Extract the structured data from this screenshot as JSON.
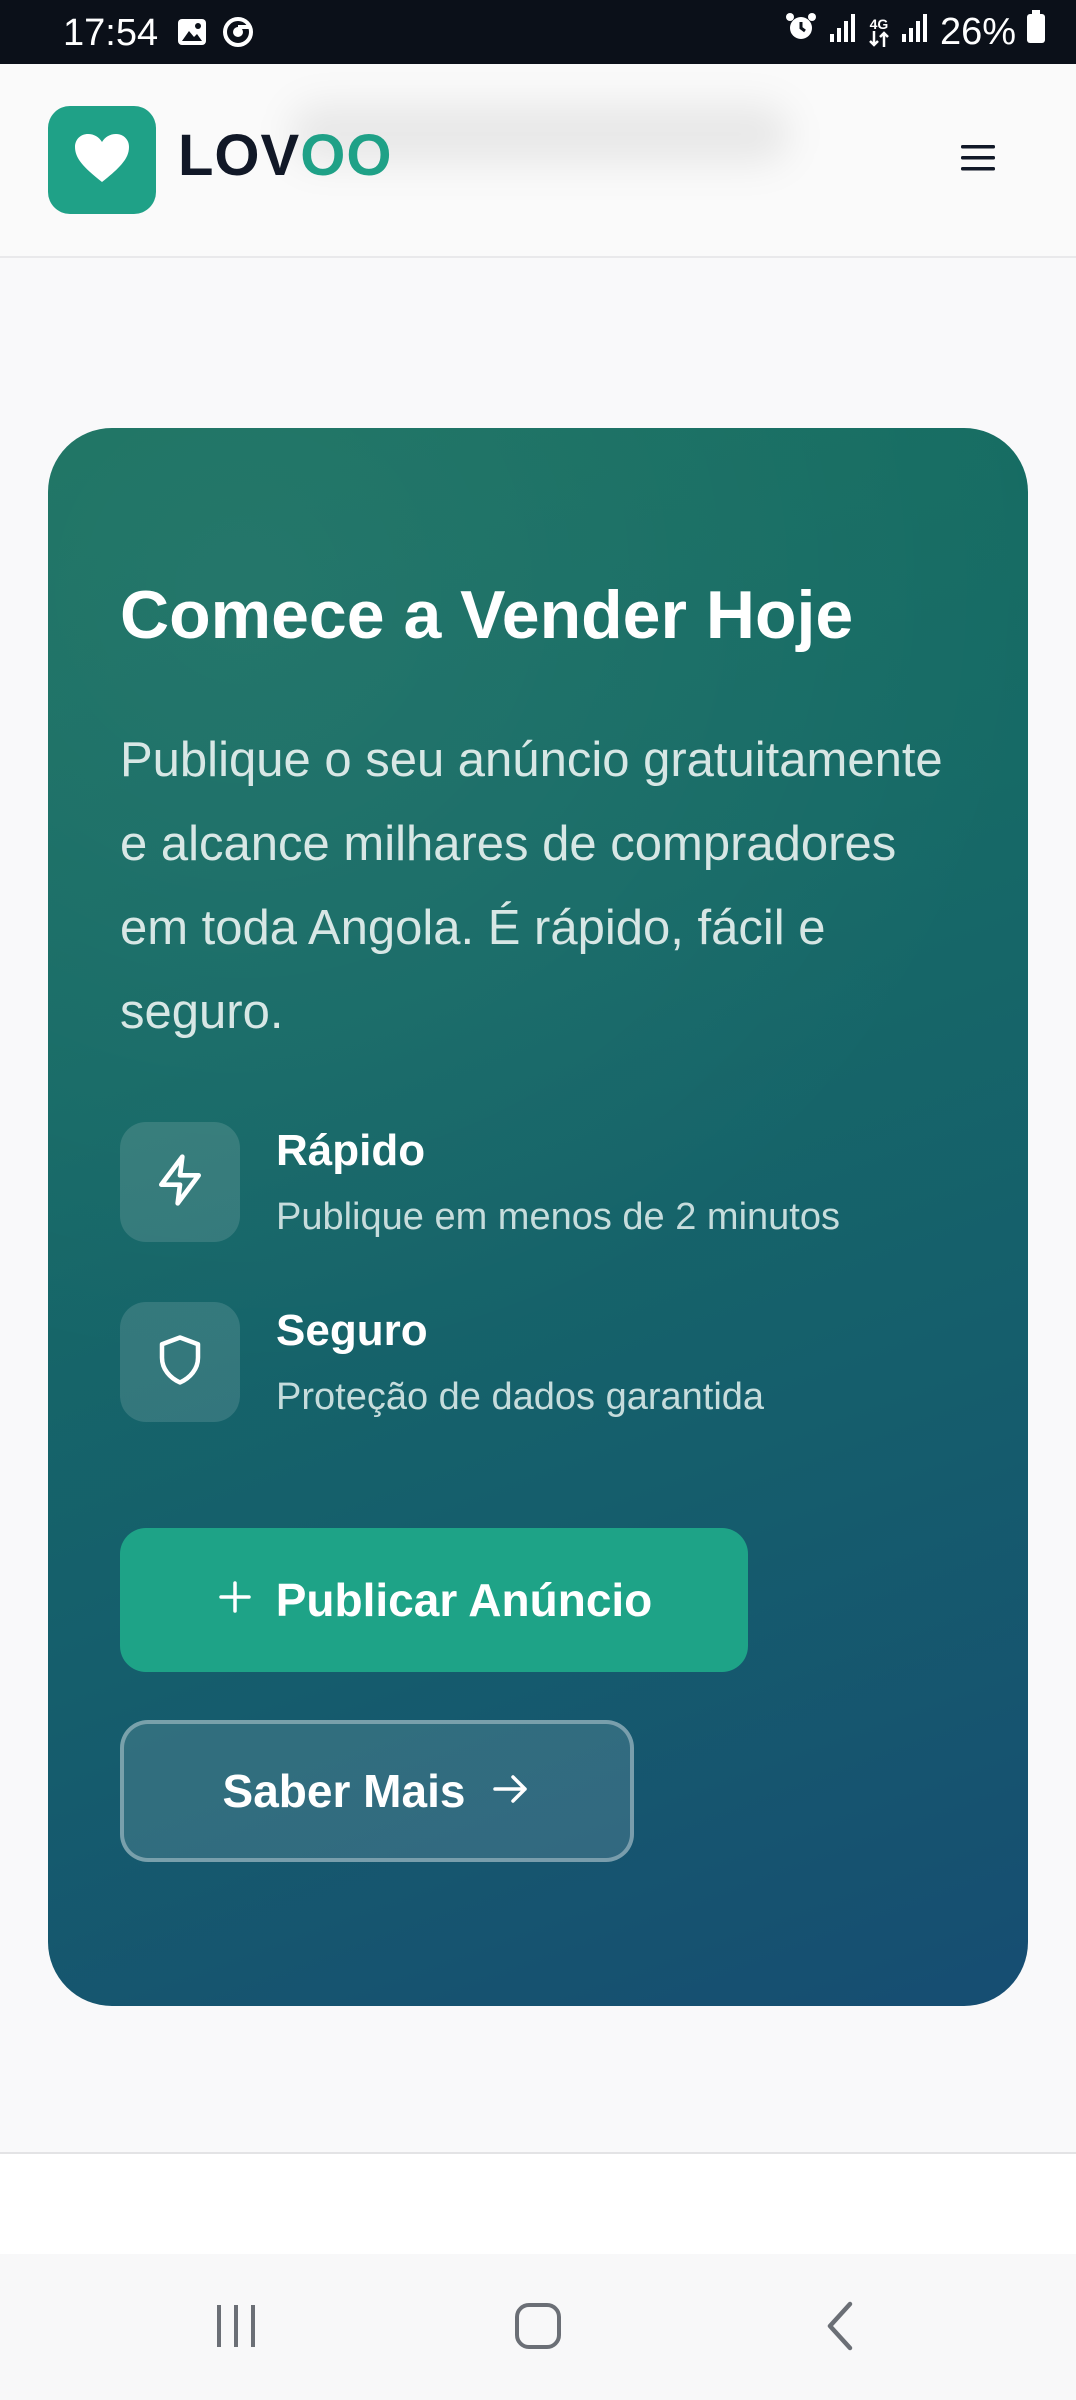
{
  "status_bar": {
    "time": "17:54",
    "left_icons": [
      "gallery-icon",
      "chrome-icon"
    ],
    "right_icons": [
      "alarm-icon",
      "signal-icon",
      "4g-data-icon",
      "signal-icon",
      "battery-icon"
    ],
    "network": "4G",
    "battery": "26%"
  },
  "header": {
    "logo_part1": "LOV",
    "logo_part2": "OO",
    "logo_icon": "heart-icon",
    "menu_icon": "hamburger-menu-icon"
  },
  "hero": {
    "title": "Comece a Vender Hoje",
    "description": "Publique o seu anúncio gratuitamente e alcance milhares de compradores em toda Angola. É rápido, fácil e seguro.",
    "features": [
      {
        "icon": "lightning-icon",
        "title": "Rápido",
        "subtitle": "Publique em menos de 2 minutos"
      },
      {
        "icon": "shield-icon",
        "title": "Seguro",
        "subtitle": "Proteção de dados garantida"
      }
    ],
    "primary_button": {
      "icon": "plus-icon",
      "label": "Publicar Anúncio"
    },
    "secondary_button": {
      "icon": "arrow-right-icon",
      "label": "Saber Mais"
    }
  },
  "system_nav": {
    "recents": "recents-icon",
    "home": "home-icon",
    "back": "back-icon"
  },
  "colors": {
    "accent": "#1fa187",
    "card_gradient_start": "#17705f",
    "card_gradient_end": "#164d72",
    "status_bar_bg": "#0b1019"
  }
}
